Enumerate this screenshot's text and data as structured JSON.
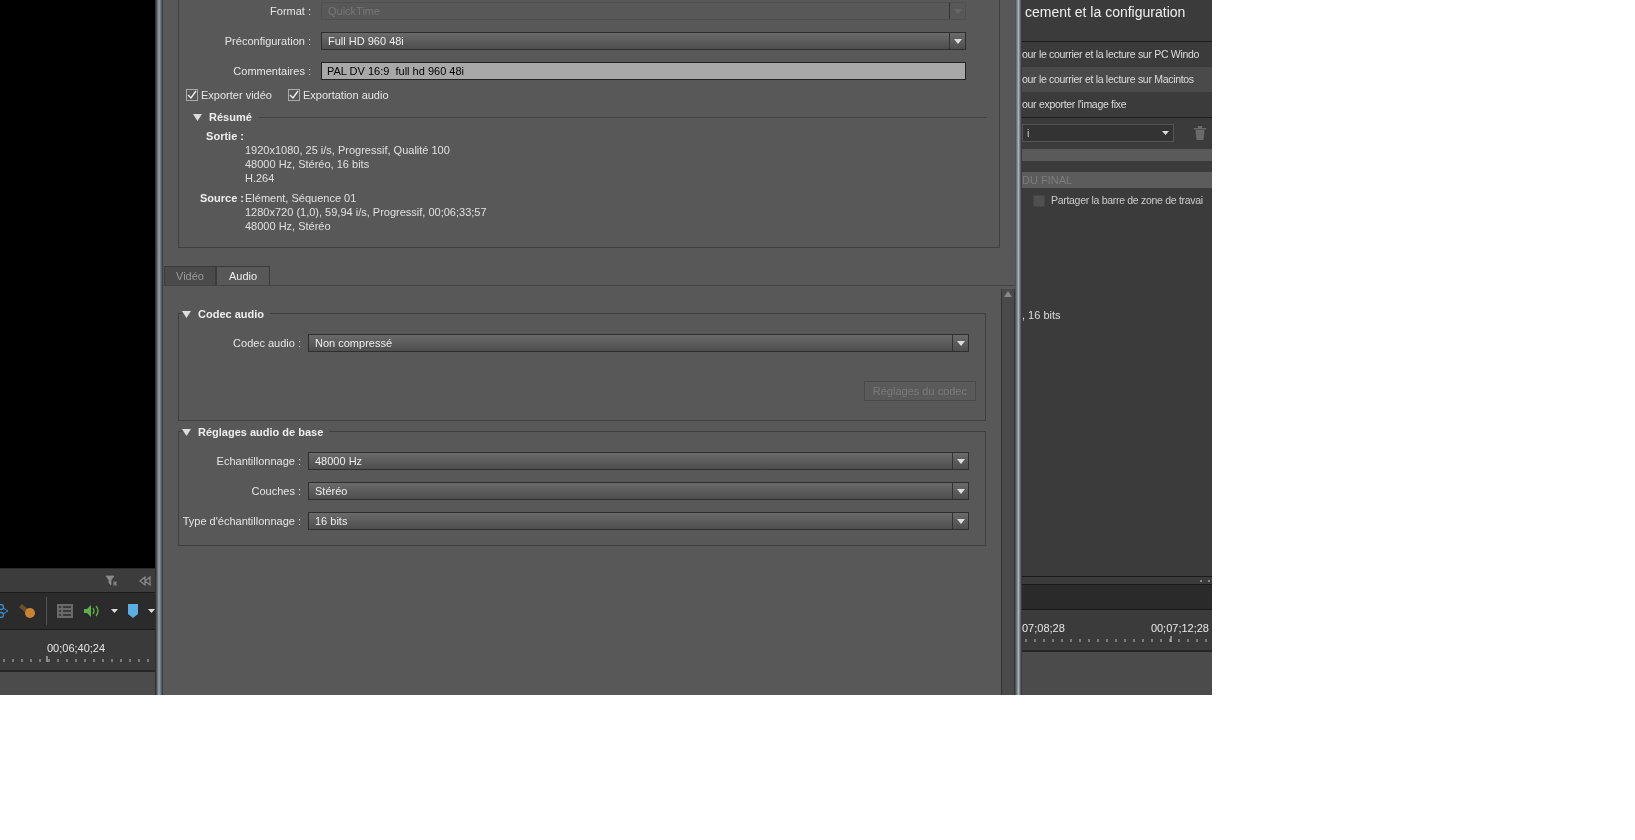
{
  "left_panel": {
    "timecode": "00;06;40;24"
  },
  "dialog": {
    "settings": [
      {
        "kind": "dropdown",
        "label": "Format :",
        "value": "QuickTime",
        "disabled": true
      },
      {
        "kind": "dropdown",
        "label": "Préconfiguration :",
        "value": "Full HD 960 48i",
        "disabled": false
      },
      {
        "kind": "text",
        "label": "Commentaires :",
        "value": "PAL DV 16:9  full hd 960 48i"
      }
    ],
    "export_options": [
      {
        "label": "Exporter vidéo",
        "checked": true
      },
      {
        "label": "Exportation audio",
        "checked": true
      }
    ],
    "summary": {
      "title": "Résumé",
      "expanded": true,
      "groups": [
        {
          "kind": "block",
          "label": "Sortie :",
          "lines": [
            "1920x1080, 25 i/s, Progressif, Qualité 100",
            "48000 Hz, Stéréo, 16 bits",
            "H.264"
          ]
        },
        {
          "kind": "inline",
          "label": "Source :",
          "lines": [
            "Elément, Séquence 01",
            "1280x720 (1,0), 59,94 i/s, Progressif, 00;06;33;57",
            "48000 Hz, Stéréo"
          ]
        }
      ]
    },
    "tabs": [
      {
        "label": "Vidéo",
        "selected": false
      },
      {
        "label": "Audio",
        "selected": true
      }
    ],
    "sections": [
      {
        "title": "Codec audio",
        "expanded": true,
        "fields": [
          {
            "label": "Codec audio :",
            "value": "Non compressé"
          }
        ],
        "button": {
          "label": "Réglages du codec",
          "disabled": true
        }
      },
      {
        "title": "Réglages audio de base",
        "expanded": true,
        "fields": [
          {
            "label": "Echantillonnage :",
            "value": "48000 Hz"
          },
          {
            "label": "Couches :",
            "value": "Stéréo"
          },
          {
            "label": "Type d'échantillonnage :",
            "value": "16 bits"
          }
        ]
      }
    ]
  },
  "right_panel": {
    "title": "cement et la configuration",
    "presets": [
      {
        "label": "our le courrier et la lecture sur PC Windo",
        "selected": false
      },
      {
        "label": "our le courrier et la lecture sur Macintos",
        "selected": true
      },
      {
        "label": "our exporter l'image fixe",
        "selected": false
      }
    ],
    "dropdown_value": "i",
    "section_header": "DU FINAL",
    "share_option": {
      "label": "Partager la barre de zone de travai",
      "checked": false
    },
    "summary_fragment": ", 16 bits",
    "timecodes": [
      "07;08;28",
      "00;07;12;28"
    ]
  }
}
